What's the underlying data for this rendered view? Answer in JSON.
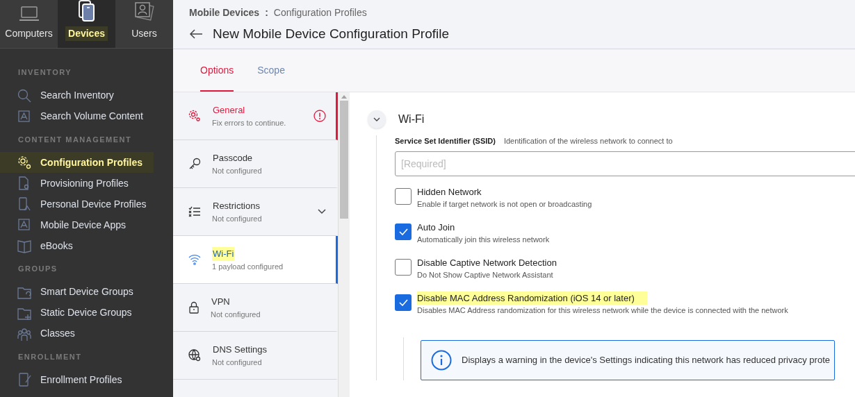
{
  "nav_tabs": [
    {
      "label": "Computers",
      "selected": false,
      "highlighted": false
    },
    {
      "label": "Devices",
      "selected": true,
      "highlighted": true
    },
    {
      "label": "Users",
      "selected": false,
      "highlighted": false
    }
  ],
  "sidebar": {
    "sections": [
      {
        "heading": "INVENTORY",
        "items": [
          {
            "label": "Search Inventory",
            "selected": false,
            "highlighted": false
          },
          {
            "label": "Search Volume Content",
            "selected": false,
            "highlighted": false
          }
        ]
      },
      {
        "heading": "CONTENT MANAGEMENT",
        "items": [
          {
            "label": "Configuration Profiles",
            "selected": true,
            "highlighted": true
          },
          {
            "label": "Provisioning Profiles",
            "selected": false,
            "highlighted": false
          },
          {
            "label": "Personal Device Profiles",
            "selected": false,
            "highlighted": false
          },
          {
            "label": "Mobile Device Apps",
            "selected": false,
            "highlighted": false
          },
          {
            "label": "eBooks",
            "selected": false,
            "highlighted": false
          }
        ]
      },
      {
        "heading": "GROUPS",
        "items": [
          {
            "label": "Smart Device Groups",
            "selected": false,
            "highlighted": false
          },
          {
            "label": "Static Device Groups",
            "selected": false,
            "highlighted": false
          },
          {
            "label": "Classes",
            "selected": false,
            "highlighted": false
          }
        ]
      },
      {
        "heading": "ENROLLMENT",
        "items": [
          {
            "label": "Enrollment Profiles",
            "selected": false,
            "highlighted": false
          }
        ]
      }
    ]
  },
  "breadcrumb": {
    "parent": "Mobile Devices",
    "separator": ":",
    "current": "Configuration Profiles"
  },
  "page_title": "New Mobile Device Configuration Profile",
  "tabs": [
    {
      "label": "Options",
      "selected": true
    },
    {
      "label": "Scope",
      "selected": false
    }
  ],
  "payloads": [
    {
      "title": "General",
      "subtitle": "Fix errors to continue.",
      "error": true,
      "selected": false,
      "highlighted": false,
      "expandable": false
    },
    {
      "title": "Passcode",
      "subtitle": "Not configured",
      "error": false,
      "selected": false,
      "highlighted": false,
      "expandable": false
    },
    {
      "title": "Restrictions",
      "subtitle": "Not configured",
      "error": false,
      "selected": false,
      "highlighted": false,
      "expandable": true
    },
    {
      "title": "Wi-Fi",
      "subtitle": "1 payload configured",
      "error": false,
      "selected": true,
      "highlighted": true,
      "expandable": false
    },
    {
      "title": "VPN",
      "subtitle": "Not configured",
      "error": false,
      "selected": false,
      "highlighted": false,
      "expandable": false
    },
    {
      "title": "DNS Settings",
      "subtitle": "Not configured",
      "error": false,
      "selected": false,
      "highlighted": false,
      "expandable": false
    }
  ],
  "section": {
    "title": "Wi-Fi",
    "expanded": true,
    "ssid_field": {
      "label": "Service Set Identifier (SSID)",
      "description": "Identification of the wireless network to connect to",
      "placeholder": "[Required]"
    },
    "options": [
      {
        "label": "Hidden Network",
        "description": "Enable if target network is not open or broadcasting",
        "checked": false,
        "highlighted": false
      },
      {
        "label": "Auto Join",
        "description": "Automatically join this wireless network",
        "checked": true,
        "highlighted": false
      },
      {
        "label": "Disable Captive Network Detection",
        "description": "Do Not Show Captive Network Assistant",
        "checked": false,
        "highlighted": false
      },
      {
        "label": "Disable MAC Address Randomization (iOS 14 or later)",
        "description": "Disables MAC Address randomization for this wireless network while the device is connected with the network",
        "checked": true,
        "highlighted": true
      }
    ],
    "info": "Displays a warning in the device's Settings indicating this network has reduced privacy prote"
  }
}
